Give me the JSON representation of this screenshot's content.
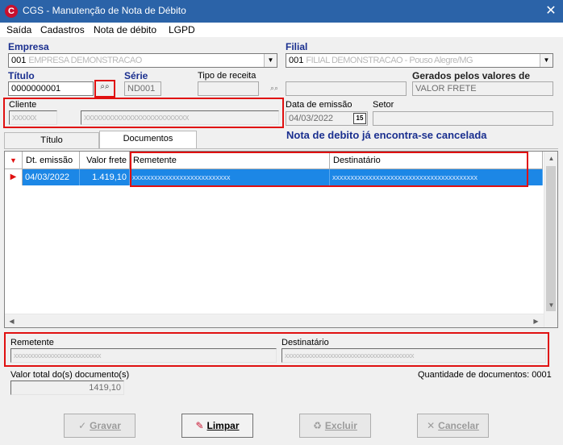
{
  "window": {
    "title": "CGS - Manutenção de Nota de Débito",
    "app_icon_letter": "C",
    "close_glyph": "✕"
  },
  "menu": [
    "Saída",
    "Cadastros",
    "Nota de débito",
    "LGPD"
  ],
  "empresa": {
    "label": "Empresa",
    "value": "001",
    "blurred": "EMPRESA DEMONSTRACAO"
  },
  "filial": {
    "label": "Filial",
    "value": "001",
    "blurred": "FILIAL DEMONSTRACAO - Pouso Alegre/MG"
  },
  "titulo": {
    "label": "Título",
    "value": "0000000001"
  },
  "serie": {
    "label": "Série",
    "value": "ND001"
  },
  "tipo_receita": {
    "label": "Tipo de receita",
    "value": ""
  },
  "gerados": {
    "label": "Gerados pelos valores de",
    "value": "VALOR FRETE"
  },
  "cliente": {
    "label": "Cliente",
    "code_mask": "xxxxxx",
    "name_mask": "xxxxxxxxxxxxxxxxxxxxxxxxxx"
  },
  "data_emissao": {
    "label": "Data de emissão",
    "value": "04/03/2022",
    "calendar_glyph": "15"
  },
  "setor": {
    "label": "Setor",
    "value": ""
  },
  "tabs": [
    "Título",
    "Documentos"
  ],
  "status_message": "Nota de debito já encontra-se cancelada",
  "grid": {
    "columns": [
      "Dt. emissão",
      "Valor frete",
      "Remetente",
      "Destinatário"
    ],
    "rows": [
      {
        "dt_emissao": "04/03/2022",
        "valor_frete": "1.419,10",
        "remetente": "xxxxxxxxxxxxxxxxxxxxxxxxxxx",
        "destinatario": "xxxxxxxxxxxxxxxxxxxxxxxxxxxxxxxxxxxxxxxx"
      }
    ]
  },
  "detail": {
    "remetente_label": "Remetente",
    "remetente_value": "xxxxxxxxxxxxxxxxxxxxxxxxxxx",
    "destinatario_label": "Destinatário",
    "destinatario_value": "xxxxxxxxxxxxxxxxxxxxxxxxxxxxxxxxxxxxxxxx"
  },
  "totals": {
    "valor_total_label": "Valor total do(s) documento(s)",
    "valor_total": "1419,10",
    "quantidade_label": "Quantidade de documentos: 0001"
  },
  "buttons": {
    "gravar": "Gravar",
    "limpar": "Limpar",
    "excluir": "Excluir",
    "cancelar": "Cancelar"
  },
  "colors": {
    "titlebar": "#2b63a8",
    "selection": "#1c87e6",
    "highlight_frame": "#e01010",
    "label_blue": "#1a2f8f"
  }
}
